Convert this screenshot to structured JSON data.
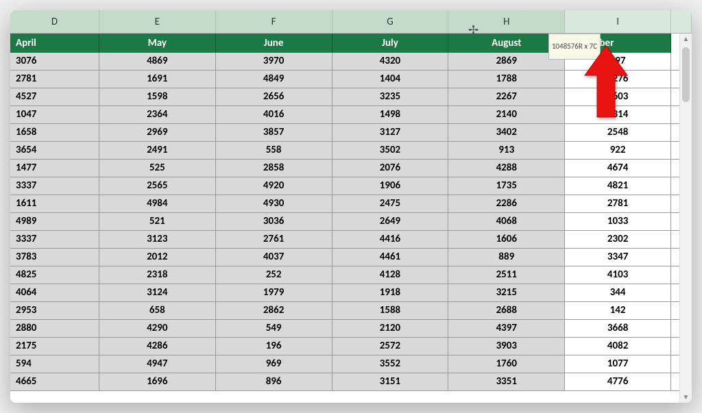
{
  "tooltip": "1048576R x 7C",
  "columns": [
    {
      "letter": "D",
      "header": "April",
      "selected": true,
      "class": "w-d",
      "firstCol": true
    },
    {
      "letter": "E",
      "header": "May",
      "selected": true,
      "class": "w-e"
    },
    {
      "letter": "F",
      "header": "June",
      "selected": true,
      "class": "w-f"
    },
    {
      "letter": "G",
      "header": "July",
      "selected": true,
      "class": "w-g"
    },
    {
      "letter": "H",
      "header": "August",
      "selected": true,
      "class": "w-h"
    },
    {
      "letter": "I",
      "header": "September",
      "selected": false,
      "class": "w-i",
      "special": "sep"
    }
  ],
  "chart_data": {
    "type": "table",
    "columns": [
      "April",
      "May",
      "June",
      "July",
      "August",
      "September"
    ],
    "rows": [
      [
        3076,
        4869,
        3970,
        4320,
        2869,
        "097"
      ],
      [
        2781,
        1691,
        4849,
        1404,
        1788,
        4276
      ],
      [
        4527,
        1598,
        2656,
        3235,
        2267,
        3603
      ],
      [
        1047,
        2364,
        4016,
        1498,
        2140,
        3314
      ],
      [
        1658,
        2969,
        3857,
        3127,
        3402,
        2548
      ],
      [
        3654,
        2491,
        558,
        3502,
        913,
        922
      ],
      [
        1477,
        525,
        2858,
        2076,
        4288,
        4674
      ],
      [
        3337,
        2565,
        4920,
        1906,
        1735,
        4821
      ],
      [
        1611,
        4984,
        4930,
        2475,
        2286,
        2781
      ],
      [
        4989,
        521,
        3036,
        2649,
        4068,
        1033
      ],
      [
        3337,
        3123,
        2761,
        4416,
        1606,
        2302
      ],
      [
        3783,
        2012,
        4037,
        4461,
        889,
        3347
      ],
      [
        4825,
        2318,
        252,
        4128,
        2511,
        4103
      ],
      [
        4064,
        3124,
        1979,
        1918,
        3215,
        344
      ],
      [
        2953,
        658,
        2862,
        1588,
        2688,
        142
      ],
      [
        2880,
        4290,
        549,
        2120,
        4397,
        3668
      ],
      [
        2175,
        4286,
        196,
        2572,
        3903,
        4082
      ],
      [
        594,
        4947,
        969,
        3552,
        1760,
        1077
      ],
      [
        4665,
        1696,
        896,
        3151,
        3351,
        4776
      ]
    ]
  },
  "scroll_arrows": {
    "up": "▲",
    "down": "▼"
  }
}
